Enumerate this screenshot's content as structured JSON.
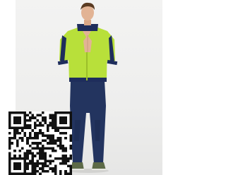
{
  "image": {
    "subject": "model-in-tracksuit",
    "colors": {
      "jacket": "#b8e03a",
      "jacket_trim": "#1e2d5c",
      "pants": "#23345f",
      "skin": "#e2b394",
      "hair": "#5a3b22",
      "shoes": "#5d6a47",
      "backdrop": "#f0f0ef"
    }
  },
  "qr_code": {
    "icon": "qr-code-icon"
  }
}
